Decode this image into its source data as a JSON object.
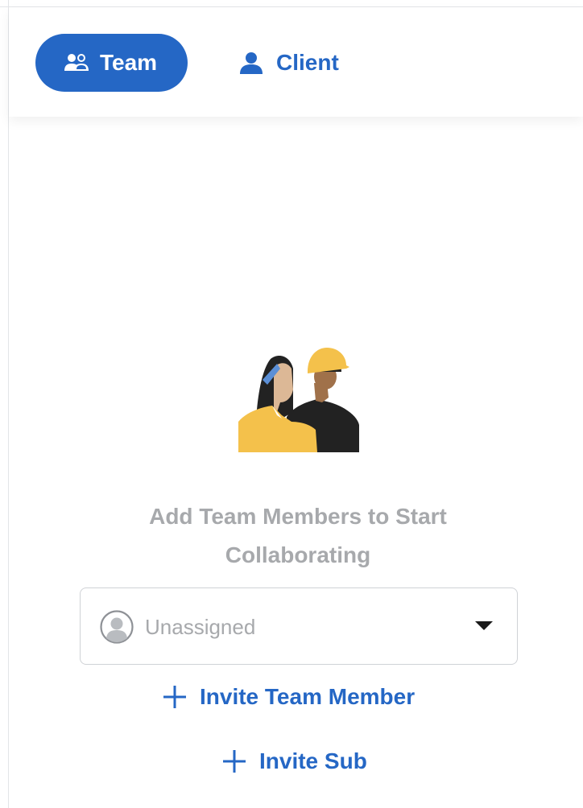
{
  "tabs": [
    {
      "label": "Team",
      "icon": "team-icon",
      "active": true
    },
    {
      "label": "Client",
      "icon": "client-icon",
      "active": false
    }
  ],
  "empty_state": {
    "illustration": "team-members-illustration",
    "message": "Add Team Members to Start Collaborating"
  },
  "assignee_select": {
    "value": "Unassigned",
    "icon": "avatar-placeholder-icon"
  },
  "actions": {
    "invite_team_member": "Invite Team Member",
    "invite_sub": "Invite Sub"
  },
  "colors": {
    "accent": "#2567c5",
    "muted_text": "#a7a9ac",
    "illustration_yellow": "#f4c14b",
    "illustration_dark": "#222222"
  }
}
